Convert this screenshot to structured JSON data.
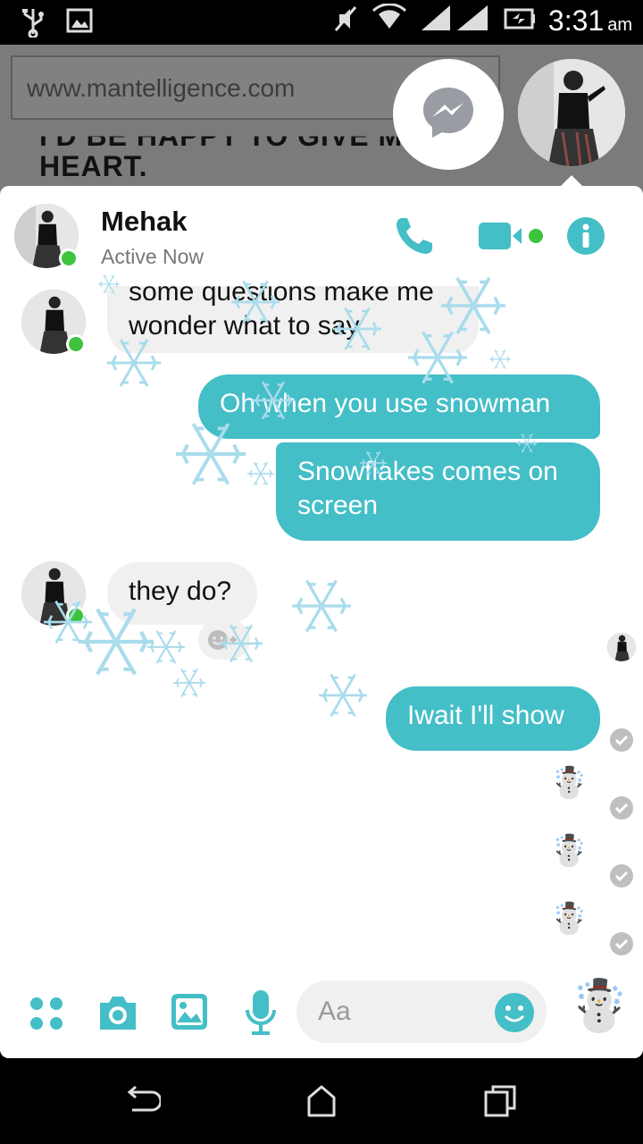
{
  "status_bar": {
    "time": "3:31",
    "ampm": "am"
  },
  "browser": {
    "url": "www.mantelligence.com",
    "page_text_line1": "I'D BE HAPPY TO GIVE MY",
    "page_text_line2": "HEART."
  },
  "chat": {
    "contact_name": "Mehak",
    "contact_status": "Active Now",
    "messages": [
      {
        "direction": "incoming",
        "text_line1": "some questions make me",
        "text_line2": "wonder what to say"
      },
      {
        "direction": "outgoing",
        "text": "Oh  when you use snowman"
      },
      {
        "direction": "outgoing",
        "text_line1": "Snowflakes comes on",
        "text_line2": "screen"
      },
      {
        "direction": "incoming",
        "text": "they do?"
      },
      {
        "direction": "outgoing",
        "text": "Iwait I'll show"
      },
      {
        "direction": "outgoing",
        "text": "☃️"
      },
      {
        "direction": "outgoing",
        "text": "☃️"
      },
      {
        "direction": "outgoing",
        "text": "☃️"
      }
    ]
  },
  "composer": {
    "placeholder": "Aa",
    "like_emoji": "☃️"
  },
  "colors": {
    "accent": "#44bec7",
    "online": "#3ec33e",
    "incoming_bubble": "#f0f0f0"
  },
  "icons": [
    "usb-icon",
    "image-icon",
    "mute-icon",
    "wifi-icon",
    "signal-icon",
    "battery-icon",
    "messenger-icon",
    "phone-icon",
    "video-icon",
    "info-icon",
    "grid-icon",
    "camera-icon",
    "gallery-icon",
    "mic-icon",
    "emoji-icon",
    "back-icon",
    "home-icon",
    "recents-icon"
  ]
}
